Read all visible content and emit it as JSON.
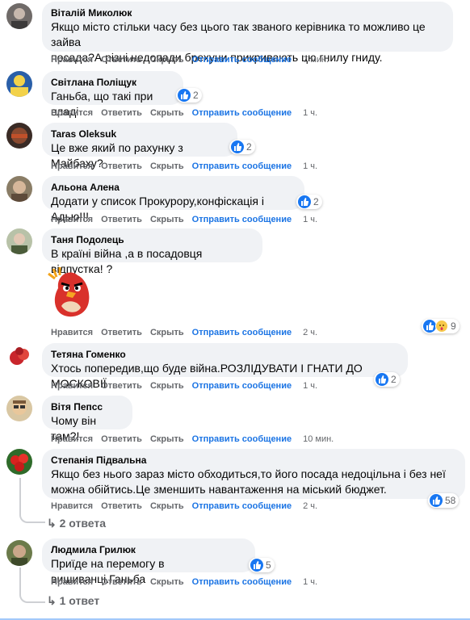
{
  "actions": {
    "like": "Нравится",
    "reply": "Ответить",
    "hide": "Скрыть",
    "message": "Отправить сообщение"
  },
  "comments": [
    {
      "author": "Віталій Миколюк",
      "lines": [
        "Якщо місто стільки часу без цього так званого керівника то можливо це зайва",
        "посада?А різні недопади брехуни прикривають цю гнилу гниду."
      ],
      "time": "7 мин."
    },
    {
      "author": "Світлана Поліщук",
      "lines": [
        "Ганьба, що такі при владі"
      ],
      "reactions": "2",
      "time": "1 ч."
    },
    {
      "author": "Taras Oleksuk",
      "lines": [
        "Це вже який по рахунку з Майбаху?"
      ],
      "reactions": "2",
      "time": "1 ч."
    },
    {
      "author": "Альона Алена",
      "lines": [
        "Додати у список Прокурору,конфіскація і Адью!!!"
      ],
      "reactions": "2",
      "time": "1 ч."
    },
    {
      "author": "Таня Подолець",
      "lines": [
        "В країні війна ,а в посадовця відпустка! ?"
      ],
      "reactions": "9",
      "time": "2 ч."
    },
    {
      "author": "Тетяна Гоменко",
      "lines": [
        "Хтось попередив,що буде війна.РОЗЛІДУВАТИ І ГНАТИ ДО МОСКОВІЇ"
      ],
      "reactions": "2",
      "time": "1 ч."
    },
    {
      "author": "Вітя Пепсс",
      "lines": [
        "Чому він там?!"
      ],
      "time": "10 мин."
    },
    {
      "author": "Степанія Підвальна",
      "lines": [
        "Якщо без нього зараз місто обходиться,то його посада недоцільна і без неї",
        "можна обійтись.Це зменшить навантаження на міський бюджет."
      ],
      "reactions": "58",
      "time": "2 ч.",
      "replies": "2 ответа"
    },
    {
      "author": "Людмила Грилюк",
      "lines": [
        "Приїде на перемогу в вишиванці.Ганьба"
      ],
      "reactions": "5",
      "time": "1 ч.",
      "replies": "1 ответ"
    }
  ]
}
